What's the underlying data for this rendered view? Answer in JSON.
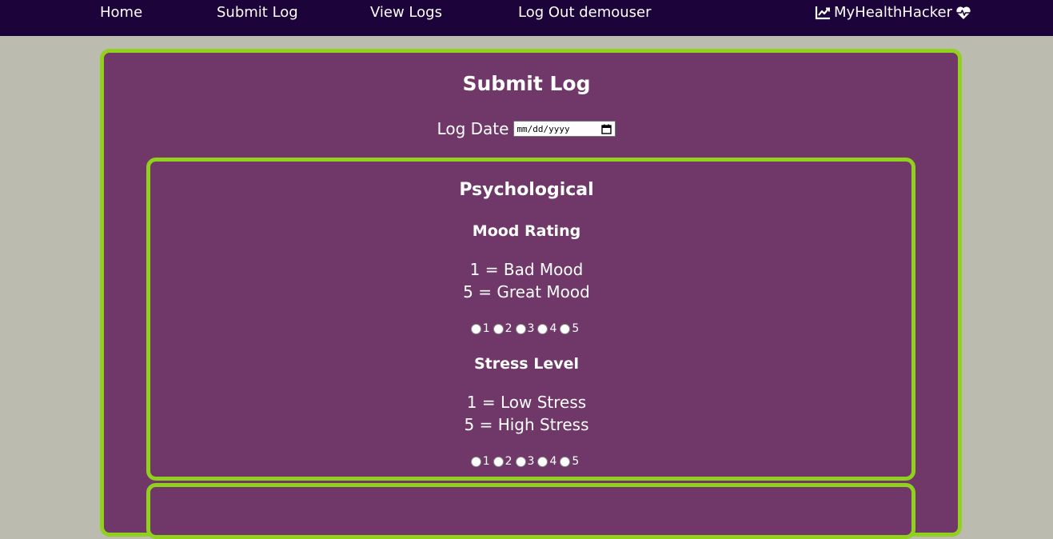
{
  "nav": {
    "home": "Home",
    "submit_log": "Submit Log",
    "view_logs": "View Logs",
    "logout": "Log Out demouser",
    "brand": "MyHealthHacker",
    "brand_left_icon": "chart-line-icon",
    "brand_right_icon": "heartbeat-icon"
  },
  "page": {
    "title": "Submit Log",
    "date_label": "Log Date",
    "date_placeholder": "mm/dd/yyyy"
  },
  "psychological": {
    "title": "Psychological",
    "mood": {
      "title": "Mood Rating",
      "line1": "1 = Bad Mood",
      "line2": "5 = Great Mood",
      "options": [
        "1",
        "2",
        "3",
        "4",
        "5"
      ]
    },
    "stress": {
      "title": "Stress Level",
      "line1": "1 = Low Stress",
      "line2": "5 = High Stress",
      "options": [
        "1",
        "2",
        "3",
        "4",
        "5"
      ]
    }
  },
  "colors": {
    "navbar": "#1c0339",
    "card": "#703769",
    "border": "#92d01e",
    "background": "#bcbbb0"
  }
}
